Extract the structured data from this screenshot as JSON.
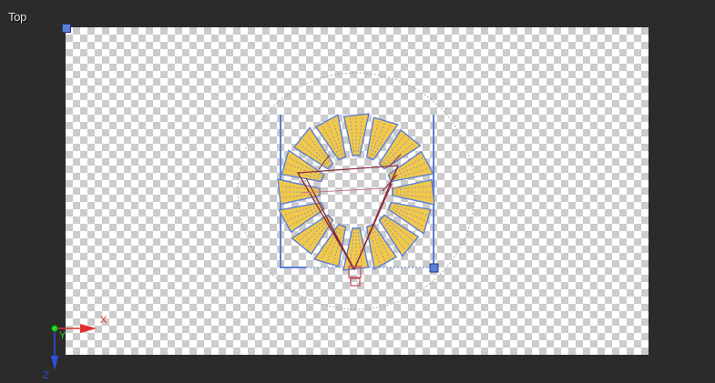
{
  "viewport": {
    "label": "Top"
  },
  "axes": {
    "x": "X",
    "y": "Y",
    "z": "Z"
  },
  "colors": {
    "background": "#2b2b2b",
    "petal_fill": "#f2c84b",
    "petal_outline": "#5b7fd6",
    "camera_lines": "#8a2a3a",
    "bounds": "#5b7fd6",
    "x_axis": "#e03030",
    "y_axis": "#2bd12b",
    "z_axis": "#3050e0"
  }
}
